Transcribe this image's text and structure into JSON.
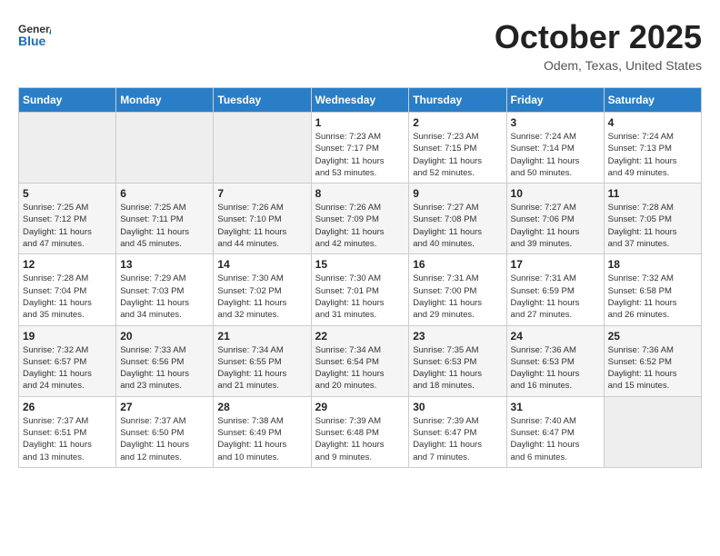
{
  "header": {
    "logo": {
      "text1": "General",
      "text2": "Blue"
    },
    "title": "October 2025",
    "subtitle": "Odem, Texas, United States"
  },
  "weekdays": [
    "Sunday",
    "Monday",
    "Tuesday",
    "Wednesday",
    "Thursday",
    "Friday",
    "Saturday"
  ],
  "weeks": [
    [
      {
        "day": "",
        "info": ""
      },
      {
        "day": "",
        "info": ""
      },
      {
        "day": "",
        "info": ""
      },
      {
        "day": "1",
        "info": "Sunrise: 7:23 AM\nSunset: 7:17 PM\nDaylight: 11 hours\nand 53 minutes."
      },
      {
        "day": "2",
        "info": "Sunrise: 7:23 AM\nSunset: 7:15 PM\nDaylight: 11 hours\nand 52 minutes."
      },
      {
        "day": "3",
        "info": "Sunrise: 7:24 AM\nSunset: 7:14 PM\nDaylight: 11 hours\nand 50 minutes."
      },
      {
        "day": "4",
        "info": "Sunrise: 7:24 AM\nSunset: 7:13 PM\nDaylight: 11 hours\nand 49 minutes."
      }
    ],
    [
      {
        "day": "5",
        "info": "Sunrise: 7:25 AM\nSunset: 7:12 PM\nDaylight: 11 hours\nand 47 minutes."
      },
      {
        "day": "6",
        "info": "Sunrise: 7:25 AM\nSunset: 7:11 PM\nDaylight: 11 hours\nand 45 minutes."
      },
      {
        "day": "7",
        "info": "Sunrise: 7:26 AM\nSunset: 7:10 PM\nDaylight: 11 hours\nand 44 minutes."
      },
      {
        "day": "8",
        "info": "Sunrise: 7:26 AM\nSunset: 7:09 PM\nDaylight: 11 hours\nand 42 minutes."
      },
      {
        "day": "9",
        "info": "Sunrise: 7:27 AM\nSunset: 7:08 PM\nDaylight: 11 hours\nand 40 minutes."
      },
      {
        "day": "10",
        "info": "Sunrise: 7:27 AM\nSunset: 7:06 PM\nDaylight: 11 hours\nand 39 minutes."
      },
      {
        "day": "11",
        "info": "Sunrise: 7:28 AM\nSunset: 7:05 PM\nDaylight: 11 hours\nand 37 minutes."
      }
    ],
    [
      {
        "day": "12",
        "info": "Sunrise: 7:28 AM\nSunset: 7:04 PM\nDaylight: 11 hours\nand 35 minutes."
      },
      {
        "day": "13",
        "info": "Sunrise: 7:29 AM\nSunset: 7:03 PM\nDaylight: 11 hours\nand 34 minutes."
      },
      {
        "day": "14",
        "info": "Sunrise: 7:30 AM\nSunset: 7:02 PM\nDaylight: 11 hours\nand 32 minutes."
      },
      {
        "day": "15",
        "info": "Sunrise: 7:30 AM\nSunset: 7:01 PM\nDaylight: 11 hours\nand 31 minutes."
      },
      {
        "day": "16",
        "info": "Sunrise: 7:31 AM\nSunset: 7:00 PM\nDaylight: 11 hours\nand 29 minutes."
      },
      {
        "day": "17",
        "info": "Sunrise: 7:31 AM\nSunset: 6:59 PM\nDaylight: 11 hours\nand 27 minutes."
      },
      {
        "day": "18",
        "info": "Sunrise: 7:32 AM\nSunset: 6:58 PM\nDaylight: 11 hours\nand 26 minutes."
      }
    ],
    [
      {
        "day": "19",
        "info": "Sunrise: 7:32 AM\nSunset: 6:57 PM\nDaylight: 11 hours\nand 24 minutes."
      },
      {
        "day": "20",
        "info": "Sunrise: 7:33 AM\nSunset: 6:56 PM\nDaylight: 11 hours\nand 23 minutes."
      },
      {
        "day": "21",
        "info": "Sunrise: 7:34 AM\nSunset: 6:55 PM\nDaylight: 11 hours\nand 21 minutes."
      },
      {
        "day": "22",
        "info": "Sunrise: 7:34 AM\nSunset: 6:54 PM\nDaylight: 11 hours\nand 20 minutes."
      },
      {
        "day": "23",
        "info": "Sunrise: 7:35 AM\nSunset: 6:53 PM\nDaylight: 11 hours\nand 18 minutes."
      },
      {
        "day": "24",
        "info": "Sunrise: 7:36 AM\nSunset: 6:53 PM\nDaylight: 11 hours\nand 16 minutes."
      },
      {
        "day": "25",
        "info": "Sunrise: 7:36 AM\nSunset: 6:52 PM\nDaylight: 11 hours\nand 15 minutes."
      }
    ],
    [
      {
        "day": "26",
        "info": "Sunrise: 7:37 AM\nSunset: 6:51 PM\nDaylight: 11 hours\nand 13 minutes."
      },
      {
        "day": "27",
        "info": "Sunrise: 7:37 AM\nSunset: 6:50 PM\nDaylight: 11 hours\nand 12 minutes."
      },
      {
        "day": "28",
        "info": "Sunrise: 7:38 AM\nSunset: 6:49 PM\nDaylight: 11 hours\nand 10 minutes."
      },
      {
        "day": "29",
        "info": "Sunrise: 7:39 AM\nSunset: 6:48 PM\nDaylight: 11 hours\nand 9 minutes."
      },
      {
        "day": "30",
        "info": "Sunrise: 7:39 AM\nSunset: 6:47 PM\nDaylight: 11 hours\nand 7 minutes."
      },
      {
        "day": "31",
        "info": "Sunrise: 7:40 AM\nSunset: 6:47 PM\nDaylight: 11 hours\nand 6 minutes."
      },
      {
        "day": "",
        "info": ""
      }
    ]
  ]
}
